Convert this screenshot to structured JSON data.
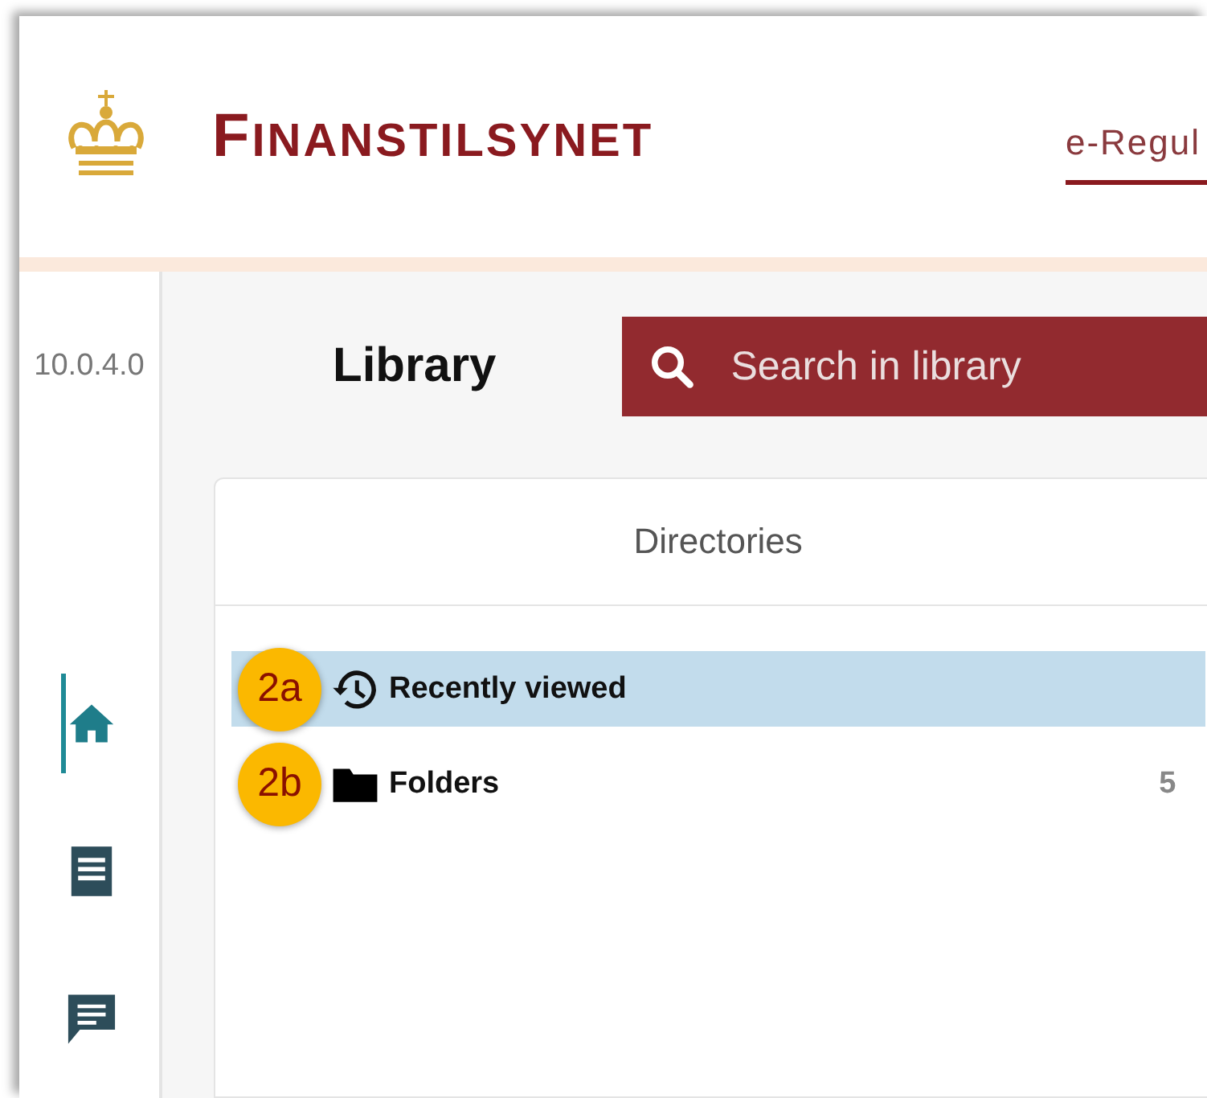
{
  "header": {
    "logo_text": "FINANSTILSYNET",
    "tabs": [
      {
        "label": "e-Regul",
        "selected": true
      }
    ]
  },
  "sidebar": {
    "version": "10.0.4.0",
    "items": [
      {
        "kind": "home",
        "selected": true
      },
      {
        "kind": "document",
        "selected": false
      },
      {
        "kind": "message",
        "selected": false
      }
    ]
  },
  "main": {
    "title": "Library",
    "search": {
      "placeholder": "Search in library"
    },
    "directories": {
      "title": "Directories",
      "rows": [
        {
          "kind": "history",
          "label": "Recently viewed",
          "badge": "2a",
          "selected": true
        },
        {
          "kind": "folder",
          "label": "Folders",
          "badge": "2b",
          "count": "5",
          "selected": false
        }
      ]
    }
  }
}
